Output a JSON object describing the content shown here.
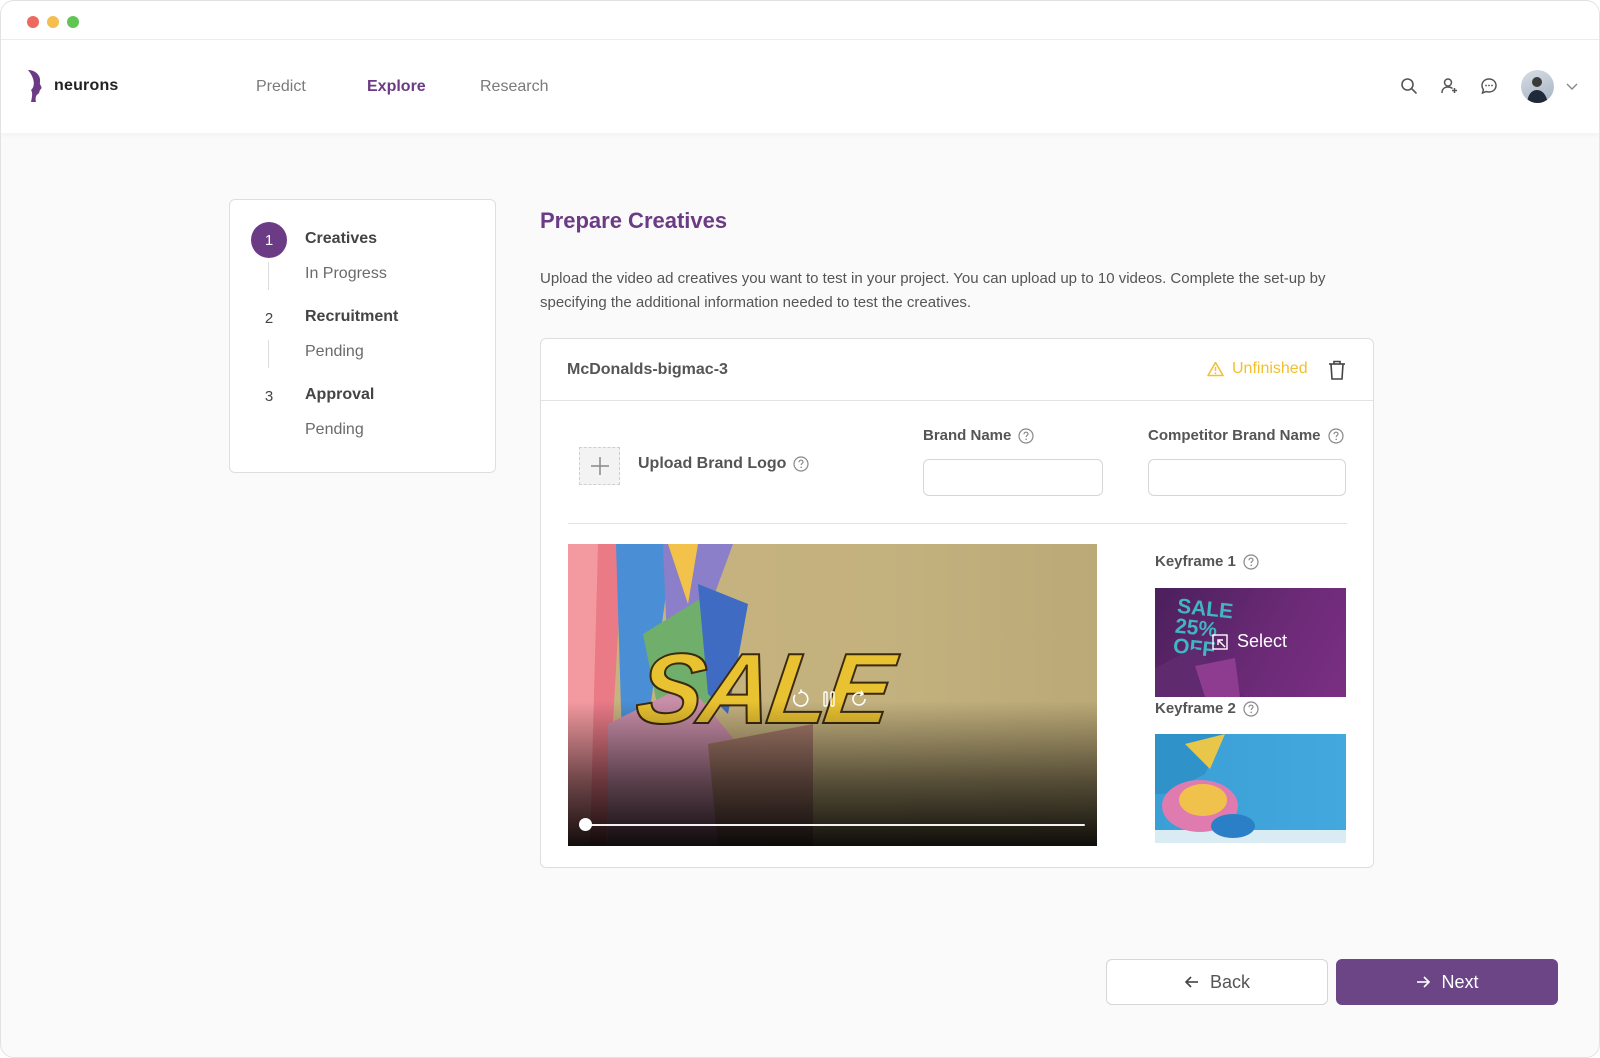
{
  "brand": {
    "name": "neurons"
  },
  "nav": {
    "links": [
      {
        "label": "Predict"
      },
      {
        "label": "Explore"
      },
      {
        "label": "Research"
      }
    ],
    "active": "Explore"
  },
  "steps": [
    {
      "number": "1",
      "title": "Creatives",
      "status": "In Progress"
    },
    {
      "number": "2",
      "title": "Recruitment",
      "status": "Pending"
    },
    {
      "number": "3",
      "title": "Approval",
      "status": "Pending"
    }
  ],
  "main": {
    "title": "Prepare Creatives",
    "description": "Upload the video ad creatives you want to test in your project. You can upload up to 10 videos. Complete the set-up by specifying the additional information needed to test the creatives."
  },
  "creative": {
    "file_name": "McDonalds-bigmac-3",
    "status": "Unfinished",
    "status_color": "#f2bf2f",
    "upload_logo_label": "Upload Brand Logo",
    "brand_name_label": "Brand Name",
    "brand_name_value": "",
    "competitor_label": "Competitor Brand Name",
    "competitor_value": "",
    "video": {
      "overlay_text": "SALE",
      "progress": 0.0
    },
    "keyframes": [
      {
        "label": "Keyframe 1",
        "action": "Select",
        "thumb_text": "SALE 25% OFF"
      },
      {
        "label": "Keyframe 2"
      }
    ]
  },
  "footer": {
    "back_label": "Back",
    "next_label": "Next"
  },
  "colors": {
    "accent": "#6b3b85",
    "button_primary": "#6b4585",
    "warning": "#f2bf2f"
  }
}
